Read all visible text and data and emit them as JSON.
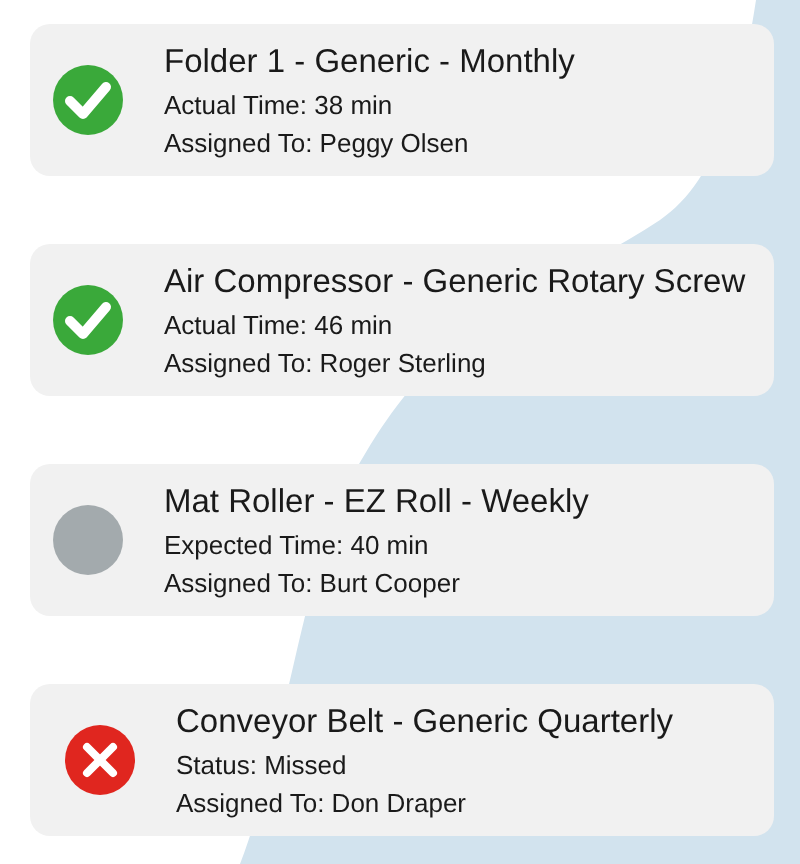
{
  "tasks": [
    {
      "kind": "done",
      "title": "Folder 1 - Generic - Monthly",
      "detail": "Actual Time: 38 min",
      "assignee": "Assigned To: Peggy Olsen"
    },
    {
      "kind": "done",
      "title": "Air Compressor - Generic Rotary Screw",
      "detail": "Actual Time: 46 min",
      "assignee": "Assigned To: Roger Sterling"
    },
    {
      "kind": "pending",
      "title": "Mat Roller - EZ Roll - Weekly",
      "detail": "Expected Time: 40 min",
      "assignee": "Assigned To: Burt Cooper"
    },
    {
      "kind": "missed",
      "title": "Conveyor Belt - Generic Quarterly",
      "detail": "Status: Missed",
      "assignee": "Assigned To: Don Draper"
    }
  ]
}
